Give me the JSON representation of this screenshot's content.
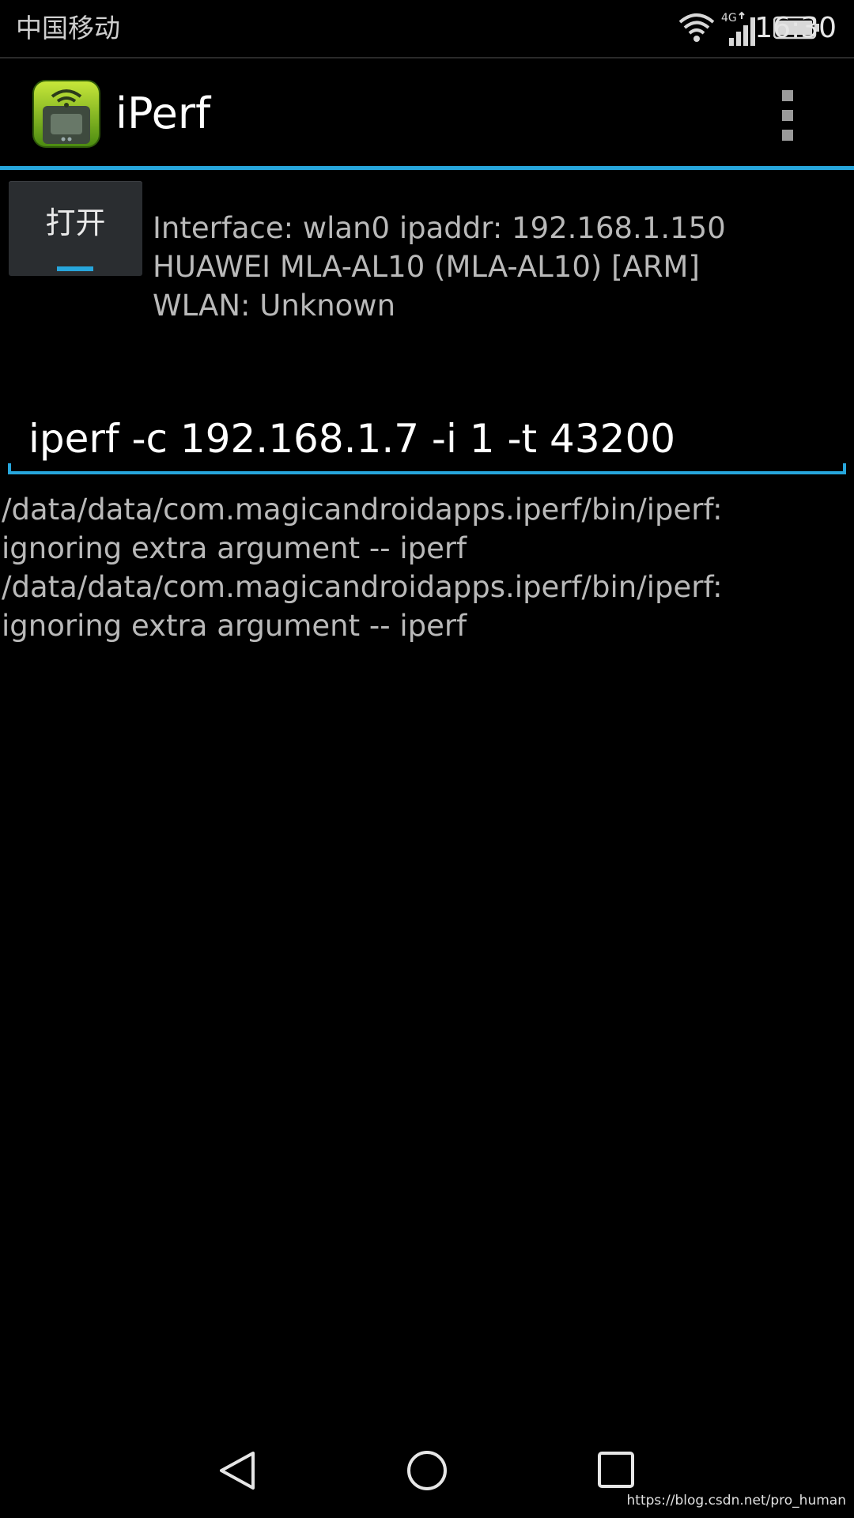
{
  "status_bar": {
    "carrier": "中国移动",
    "network_type": "4G",
    "time": "16:30",
    "icons": [
      "wifi-icon",
      "signal-icon",
      "battery-icon"
    ]
  },
  "action_bar": {
    "title": "iPerf",
    "app_icon": "iperf-app-icon",
    "overflow_icon": "overflow-menu-icon"
  },
  "toggle_button": {
    "label": "打开"
  },
  "info": {
    "lines": [
      "Interface: wlan0 ipaddr: 192.168.1.150",
      "HUAWEI MLA-AL10 (MLA-AL10) [ARM]",
      "WLAN: Unknown"
    ]
  },
  "command": {
    "value": "iperf -c 192.168.1.7 -i 1 -t 43200"
  },
  "output": {
    "lines": [
      "/data/data/com.magicandroidapps.iperf/bin/iperf:",
      "ignoring extra argument -- iperf",
      "/data/data/com.magicandroidapps.iperf/bin/iperf:",
      "ignoring extra argument -- iperf"
    ]
  },
  "nav_bar": {
    "icons": [
      "back-icon",
      "home-icon",
      "recent-apps-icon"
    ]
  },
  "watermark": "https://blog.csdn.net/pro_human",
  "colors": {
    "accent": "#27a6dc",
    "background": "#000000",
    "secondary_text": "#b9b9b9",
    "button_bg": "#2a2d30"
  }
}
